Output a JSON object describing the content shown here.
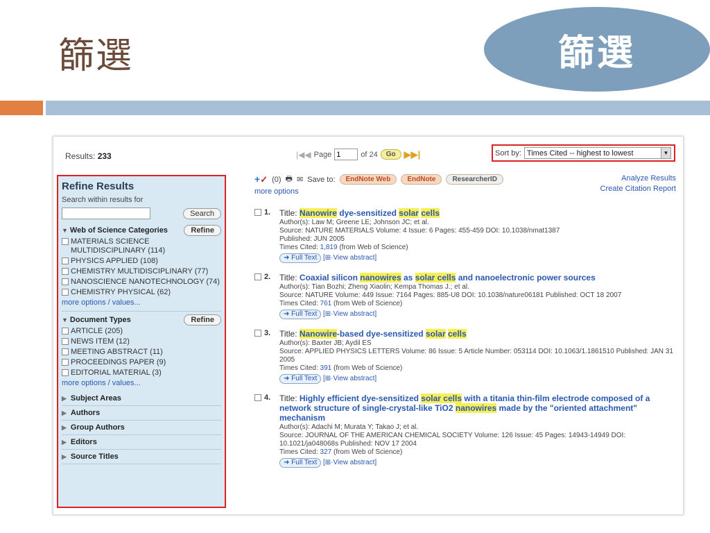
{
  "slide": {
    "title": "篩選",
    "badge": "篩選"
  },
  "toolbar": {
    "results_label": "Results:",
    "results_count": "233",
    "page_label": "Page",
    "page_value": "1",
    "of_label": "of 24",
    "go": "Go",
    "sort_label": "Sort by:",
    "sort_value": "Times Cited -- highest to lowest"
  },
  "refine": {
    "heading": "Refine Results",
    "search_within": "Search within results for",
    "search_btn": "Search",
    "refine_btn": "Refine",
    "wos_heading": "Web of Science Categories",
    "wos": [
      "MATERIALS SCIENCE MULTIDISCIPLINARY (114)",
      "PHYSICS APPLIED (108)",
      "CHEMISTRY MULTIDISCIPLINARY (77)",
      "NANOSCIENCE NANOTECHNOLOGY (74)",
      "CHEMISTRY PHYSICAL (62)"
    ],
    "more": "more options / values...",
    "doc_heading": "Document Types",
    "doc": [
      "ARTICLE (205)",
      "NEWS ITEM (12)",
      "MEETING ABSTRACT (11)",
      "PROCEEDINGS PAPER (9)",
      "EDITORIAL MATERIAL (3)"
    ],
    "collapsed": [
      "Subject Areas",
      "Authors",
      "Group Authors",
      "Editors",
      "Source Titles"
    ]
  },
  "actions": {
    "count": "(0)",
    "save_to": "Save to:",
    "endnote_web": "EndNote Web",
    "endnote": "EndNote",
    "researcherid": "ResearcherID",
    "more_options": "more options",
    "analyze": "Analyze Results",
    "citation": "Create Citation Report"
  },
  "records": [
    {
      "num": "1.",
      "title_parts": [
        "Nanowire",
        " dye-sensitized ",
        "solar",
        " ",
        "cells"
      ],
      "authors": "Author(s): Law M; Greene LE; Johnson JC; et al.",
      "source": "Source: NATURE MATERIALS  Volume: 4  Issue: 6  Pages: 455-459  DOI: 10.1038/nmat1387",
      "published": "Published: JUN 2005",
      "cited_pre": "Times Cited: ",
      "cited": "1,819",
      "cited_post": " (from Web of Science)"
    },
    {
      "num": "2.",
      "title_parts": [
        "Coaxial silicon ",
        "nanowires",
        " as ",
        "solar cells",
        " and nanoelectronic power sources"
      ],
      "authors": "Author(s): Tian Bozhi; Zheng Xiaolin; Kempa Thomas J.; et al.",
      "source": "Source: NATURE  Volume: 449  Issue: 7164  Pages: 885-U8  DOI: 10.1038/nature06181  Published: OCT 18 2007",
      "published": "",
      "cited_pre": "Times Cited: ",
      "cited": "761",
      "cited_post": " (from Web of Science)"
    },
    {
      "num": "3.",
      "title_parts": [
        "Nanowire",
        "-based dye-sensitized ",
        "solar",
        " ",
        "cells"
      ],
      "authors": "Author(s): Baxter JB; Aydil ES",
      "source": "Source: APPLIED PHYSICS LETTERS  Volume: 86  Issue: 5   Article Number: 053114  DOI: 10.1063/1.1861510  Published: JAN 31 2005",
      "published": "",
      "cited_pre": "Times Cited: ",
      "cited": "391",
      "cited_post": " (from Web of Science)"
    },
    {
      "num": "4.",
      "title_parts": [
        "Highly efficient dye-sensitized ",
        "solar cells",
        " with a titania thin-film electrode composed of a network structure of single-crystal-like TiO2 ",
        "nanowires",
        " made by the \"oriented attachment\" mechanism"
      ],
      "authors": "Author(s): Adachi M; Murata Y; Takao J; et al.",
      "source": "Source: JOURNAL OF THE AMERICAN CHEMICAL SOCIETY  Volume: 126  Issue: 45  Pages: 14943-14949  DOI: 10.1021/ja048068s  Published: NOV 17 2004",
      "published": "",
      "cited_pre": "Times Cited: ",
      "cited": "327",
      "cited_post": " (from Web of Science)"
    }
  ],
  "full_text": "Full Text",
  "view_abstract": "View abstract"
}
